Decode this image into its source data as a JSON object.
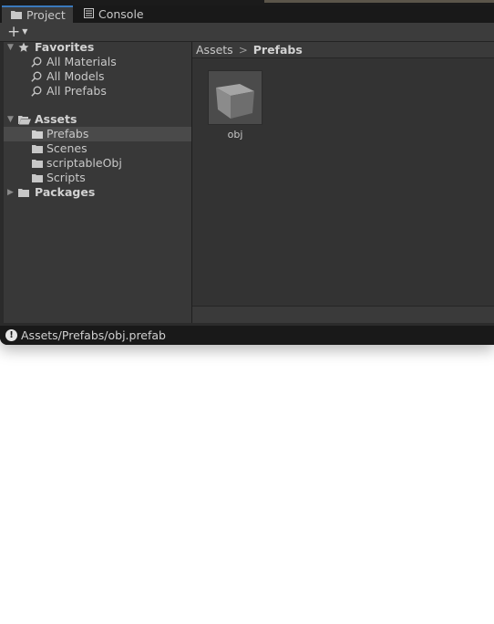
{
  "tabs": [
    {
      "label": "Project",
      "icon": "folder-icon",
      "active": true
    },
    {
      "label": "Console",
      "icon": "console-icon",
      "active": false
    }
  ],
  "toolbar": {
    "add_label": "+"
  },
  "tree": {
    "favorites": {
      "label": "Favorites",
      "items": [
        "All Materials",
        "All Models",
        "All Prefabs"
      ]
    },
    "assets": {
      "label": "Assets",
      "items": [
        "Prefabs",
        "Scenes",
        "scriptableObj",
        "Scripts"
      ]
    },
    "packages": {
      "label": "Packages"
    }
  },
  "breadcrumb": {
    "root": "Assets",
    "current": "Prefabs"
  },
  "assets": [
    {
      "label": "obj"
    }
  ],
  "status": {
    "path": "Assets/Prefabs/obj.prefab"
  },
  "colors": {
    "accent": "#3a79bb",
    "panel": "#383838",
    "selection": "#4a4a4a"
  }
}
